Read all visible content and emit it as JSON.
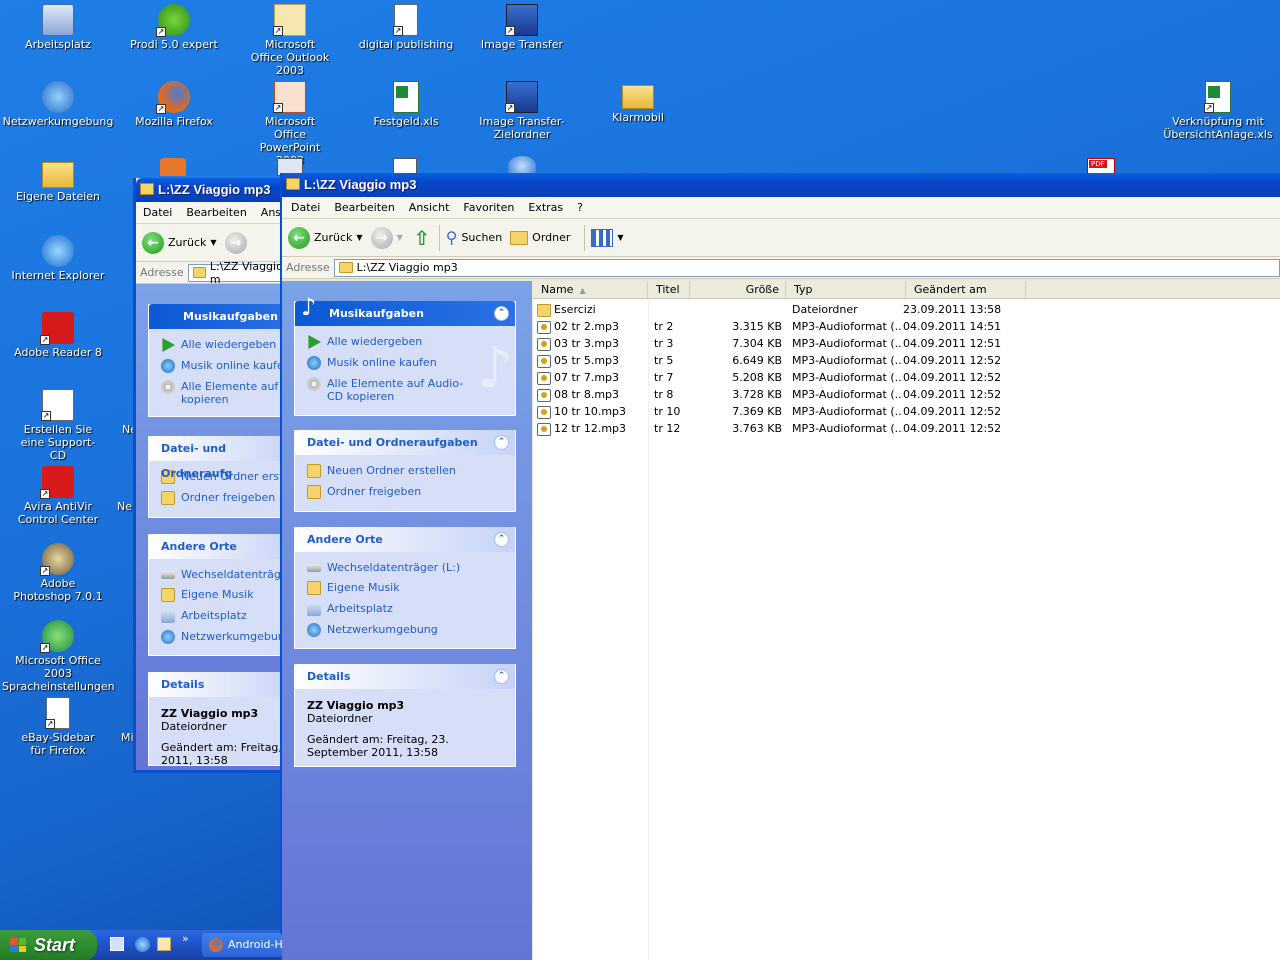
{
  "desktop": {
    "icons": [
      {
        "label": "Arbeitsplatz",
        "icon": "computer-icon"
      },
      {
        "label": "Prodi 5.0 expert",
        "icon": "app-icon"
      },
      {
        "label": "Microsoft Office Outlook 2003",
        "icon": "outlook-icon"
      },
      {
        "label": "digital publishing",
        "icon": "document-icon"
      },
      {
        "label": "Image Transfer",
        "icon": "image-transfer-icon"
      },
      {
        "label": "Netzwerkumgebung",
        "icon": "network-icon"
      },
      {
        "label": "Mozilla Firefox",
        "icon": "firefox-icon"
      },
      {
        "label": "Microsoft Office PowerPoint 2003",
        "icon": "powerpoint-icon"
      },
      {
        "label": "Festgeld.xls",
        "icon": "excel-icon"
      },
      {
        "label": "Image Transfer-Zielordner",
        "icon": "image-transfer-icon"
      },
      {
        "label": "Klarmobil",
        "icon": "folder-icon"
      },
      {
        "label": "Verknüpfung mit ÜbersichtAnlage.xls",
        "icon": "excel-icon"
      },
      {
        "label": "Eigene Dateien",
        "icon": "folder-icon"
      },
      {
        "label": "Internet Explorer",
        "icon": "ie-icon"
      },
      {
        "label": "Adobe Reader 8",
        "icon": "adobe-reader-icon"
      },
      {
        "label": "Erstellen Sie eine Support-CD",
        "icon": "support-cd-icon"
      },
      {
        "label": "Avira AntiVir Control Center",
        "icon": "avira-icon"
      },
      {
        "label": "Adobe Photoshop 7.0.1",
        "icon": "photoshop-icon"
      },
      {
        "label": "Microsoft Office 2003 Spracheinstellungen",
        "icon": "office-language-icon"
      },
      {
        "label": "eBay-Sidebar für Firefox",
        "icon": "document-icon"
      }
    ],
    "partial_labels": [
      "Ne",
      "Ne",
      "Mi"
    ]
  },
  "back_window": {
    "title": "L:\\ZZ Viaggio mp3",
    "menu": [
      "Datei",
      "Bearbeiten",
      "Ansic"
    ],
    "back_label": "Zurück",
    "address_label": "Adresse",
    "address_value": "L:\\ZZ Viaggio m",
    "music_tasks": {
      "title": "Musikaufgaben",
      "items": [
        "Alle wiedergeben",
        "Musik online kaufen",
        "Alle Elemente auf Au kopieren"
      ]
    },
    "file_tasks": {
      "title": "Datei- und Ordneraufg",
      "items": [
        "Neuen Ordner erste",
        "Ordner freigeben"
      ]
    },
    "other_places": {
      "title": "Andere Orte",
      "items": [
        "Wechseldatenträger",
        "Eigene Musik",
        "Arbeitsplatz",
        "Netzwerkumgebung"
      ]
    },
    "details": {
      "title": "Details",
      "name": "ZZ Viaggio mp3",
      "type": "Dateiordner",
      "modified": "Geändert am: Freitag, 2",
      "modified2": "2011, 13:58"
    }
  },
  "front_window": {
    "title": "L:\\ZZ Viaggio mp3",
    "menu": [
      "Datei",
      "Bearbeiten",
      "Ansicht",
      "Favoriten",
      "Extras",
      "?"
    ],
    "toolbar": {
      "back": "Zurück",
      "search": "Suchen",
      "folders": "Ordner"
    },
    "address_label": "Adresse",
    "address_value": "L:\\ZZ Viaggio mp3",
    "music_tasks": {
      "title": "Musikaufgaben",
      "items": [
        "Alle wiedergeben",
        "Musik online kaufen",
        "Alle Elemente auf Audio-CD kopieren"
      ]
    },
    "file_tasks": {
      "title": "Datei- und Ordneraufgaben",
      "items": [
        "Neuen Ordner erstellen",
        "Ordner freigeben"
      ]
    },
    "other_places": {
      "title": "Andere Orte",
      "items": [
        "Wechseldatenträger (L:)",
        "Eigene Musik",
        "Arbeitsplatz",
        "Netzwerkumgebung"
      ]
    },
    "details": {
      "title": "Details",
      "name": "ZZ Viaggio mp3",
      "type": "Dateiordner",
      "modified": "Geändert am: Freitag, 23. September 2011, 13:58"
    },
    "columns": [
      "Name",
      "Titel",
      "Größe",
      "Typ",
      "Geändert am"
    ],
    "files": [
      {
        "name": "Esercizi",
        "title": "",
        "size": "",
        "type": "Dateiordner",
        "modified": "23.09.2011 13:58",
        "kind": "folder"
      },
      {
        "name": "02 tr 2.mp3",
        "title": "tr 2",
        "size": "3.315 KB",
        "type": "MP3-Audioformat (...",
        "modified": "04.09.2011 14:51",
        "kind": "mp3"
      },
      {
        "name": "03 tr 3.mp3",
        "title": "tr 3",
        "size": "7.304 KB",
        "type": "MP3-Audioformat (...",
        "modified": "04.09.2011 12:51",
        "kind": "mp3"
      },
      {
        "name": "05 tr 5.mp3",
        "title": "tr 5",
        "size": "6.649 KB",
        "type": "MP3-Audioformat (...",
        "modified": "04.09.2011 12:52",
        "kind": "mp3"
      },
      {
        "name": "07 tr 7.mp3",
        "title": "tr 7",
        "size": "5.208 KB",
        "type": "MP3-Audioformat (...",
        "modified": "04.09.2011 12:52",
        "kind": "mp3"
      },
      {
        "name": "08 tr 8.mp3",
        "title": "tr 8",
        "size": "3.728 KB",
        "type": "MP3-Audioformat (...",
        "modified": "04.09.2011 12:52",
        "kind": "mp3"
      },
      {
        "name": "10 tr 10.mp3",
        "title": "tr 10",
        "size": "7.369 KB",
        "type": "MP3-Audioformat (...",
        "modified": "04.09.2011 12:52",
        "kind": "mp3"
      },
      {
        "name": "12 tr 12.mp3",
        "title": "tr 12",
        "size": "3.763 KB",
        "type": "MP3-Audioformat (...",
        "modified": "04.09.2011 12:52",
        "kind": "mp3"
      }
    ]
  },
  "taskbar": {
    "start_label": "Start",
    "task_label": "Android-Hi",
    "chevron": "»"
  }
}
